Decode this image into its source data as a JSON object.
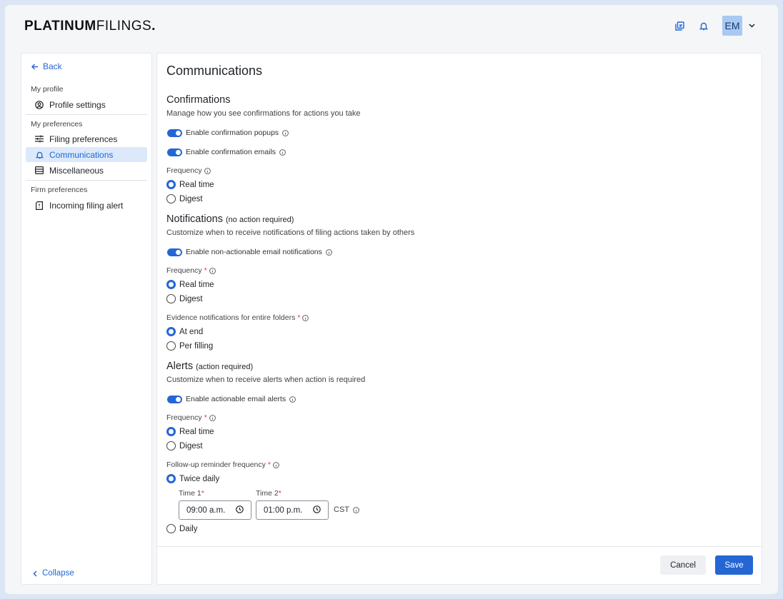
{
  "brand": {
    "part1": "PLATINUM",
    "part2": "FILINGS",
    "dot": "."
  },
  "header": {
    "avatar_initials": "EM",
    "icons": [
      "copy-icon",
      "bell-icon",
      "chevron-down-icon"
    ]
  },
  "sidebar": {
    "back_label": "Back",
    "sections": [
      {
        "label": "My profile"
      },
      {
        "label": "My preferences"
      },
      {
        "label": "Firm preferences"
      }
    ],
    "items": [
      {
        "label": "Profile settings",
        "icon": "user-circle-icon"
      },
      {
        "label": "Filing preferences",
        "icon": "sliders-icon"
      },
      {
        "label": "Communications",
        "icon": "bell-icon",
        "active": true
      },
      {
        "label": "Miscellaneous",
        "icon": "list-icon"
      },
      {
        "label": "Incoming filing alert",
        "icon": "document-alert-icon"
      }
    ],
    "collapse_label": "Collapse"
  },
  "main": {
    "title": "Communications",
    "confirmations": {
      "heading": "Confirmations",
      "description": "Manage how you see confirmations for actions you take",
      "toggle1": "Enable confirmation popups",
      "toggle2": "Enable confirmation emails",
      "frequency_label": "Frequency",
      "options": [
        "Real time",
        "Digest"
      ],
      "selected": "Real time"
    },
    "notifications": {
      "heading": "Notifications",
      "heading_note": "(no action required)",
      "description": "Customize when to receive notifications of filing actions taken by others",
      "toggle": "Enable non-actionable email notifications",
      "frequency_label": "Frequency",
      "options": [
        "Real time",
        "Digest"
      ],
      "selected": "Real time",
      "evidence_label": "Evidence notifications for entire folders",
      "evidence_options": [
        "At end",
        "Per filling"
      ],
      "evidence_selected": "At end"
    },
    "alerts": {
      "heading": "Alerts",
      "heading_note": "(action required)",
      "description": "Customize when to receive alerts when action is required",
      "toggle": "Enable actionable email alerts",
      "frequency_label": "Frequency",
      "options": [
        "Real time",
        "Digest"
      ],
      "selected": "Real time",
      "followup_label": "Follow-up reminder frequency",
      "followup_options": [
        "Twice daily",
        "Daily"
      ],
      "followup_selected": "Twice daily",
      "time1_label": "Time 1",
      "time1_value": "09:00 a.m.",
      "time2_label": "Time 2",
      "time2_value": "01:00 p.m.",
      "timezone": "CST"
    },
    "actions": {
      "cancel": "Cancel",
      "save": "Save"
    }
  },
  "colors": {
    "accent": "#2466d4",
    "active_bg": "#dbe9fb",
    "required": "#d43b3b"
  }
}
